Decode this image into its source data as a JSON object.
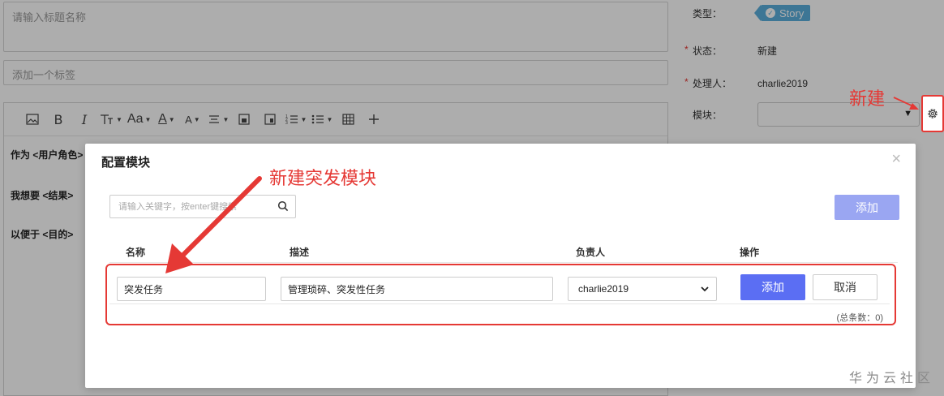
{
  "form": {
    "title_placeholder": "请输入标题名称",
    "tag_placeholder": "添加一个标签",
    "editor_lines": [
      "作为 <用户角色>",
      "我想要 <结果>",
      "以便于 <目的>"
    ]
  },
  "toolbar": {
    "icons": [
      "image-icon",
      "bold-icon",
      "italic-icon",
      "text-size-icon",
      "font-family-icon",
      "font-color-icon",
      "highlight-icon",
      "align-icon",
      "file-icon",
      "template-icon",
      "ordered-list-icon",
      "unordered-list-icon",
      "table-icon",
      "plus-icon"
    ],
    "bold_glyph": "B",
    "italic_glyph": "I",
    "font_glyph": "Aa",
    "color_glyph": "A",
    "highlight_glyph": "A"
  },
  "details": {
    "type_label": "类型：",
    "type_value": "Story",
    "status_label": "状态：",
    "status_value": "新建",
    "assignee_label": "处理人：",
    "assignee_value": "charlie2019",
    "module_label": "模块："
  },
  "modal": {
    "title": "配置模块",
    "search_placeholder": "请输入关键字，按enter键搜索",
    "add_button": "添加",
    "columns": {
      "name": "名称",
      "description": "描述",
      "owner": "负责人",
      "actions": "操作"
    },
    "row": {
      "name": "突发任务",
      "description": "管理琐碎、突发性任务",
      "owner": "charlie2019",
      "add_button": "添加",
      "cancel_button": "取消"
    },
    "total_text": "(总条数：0)"
  },
  "annotations": {
    "new_label": "新建",
    "new_module_label": "新建突发模块"
  },
  "watermark": "华为云社区",
  "colors": {
    "primary": "#5b6ef3",
    "primary_disabled": "#9aa6f2",
    "annotation_red": "#e53935",
    "story_badge": "#5aaedc"
  }
}
